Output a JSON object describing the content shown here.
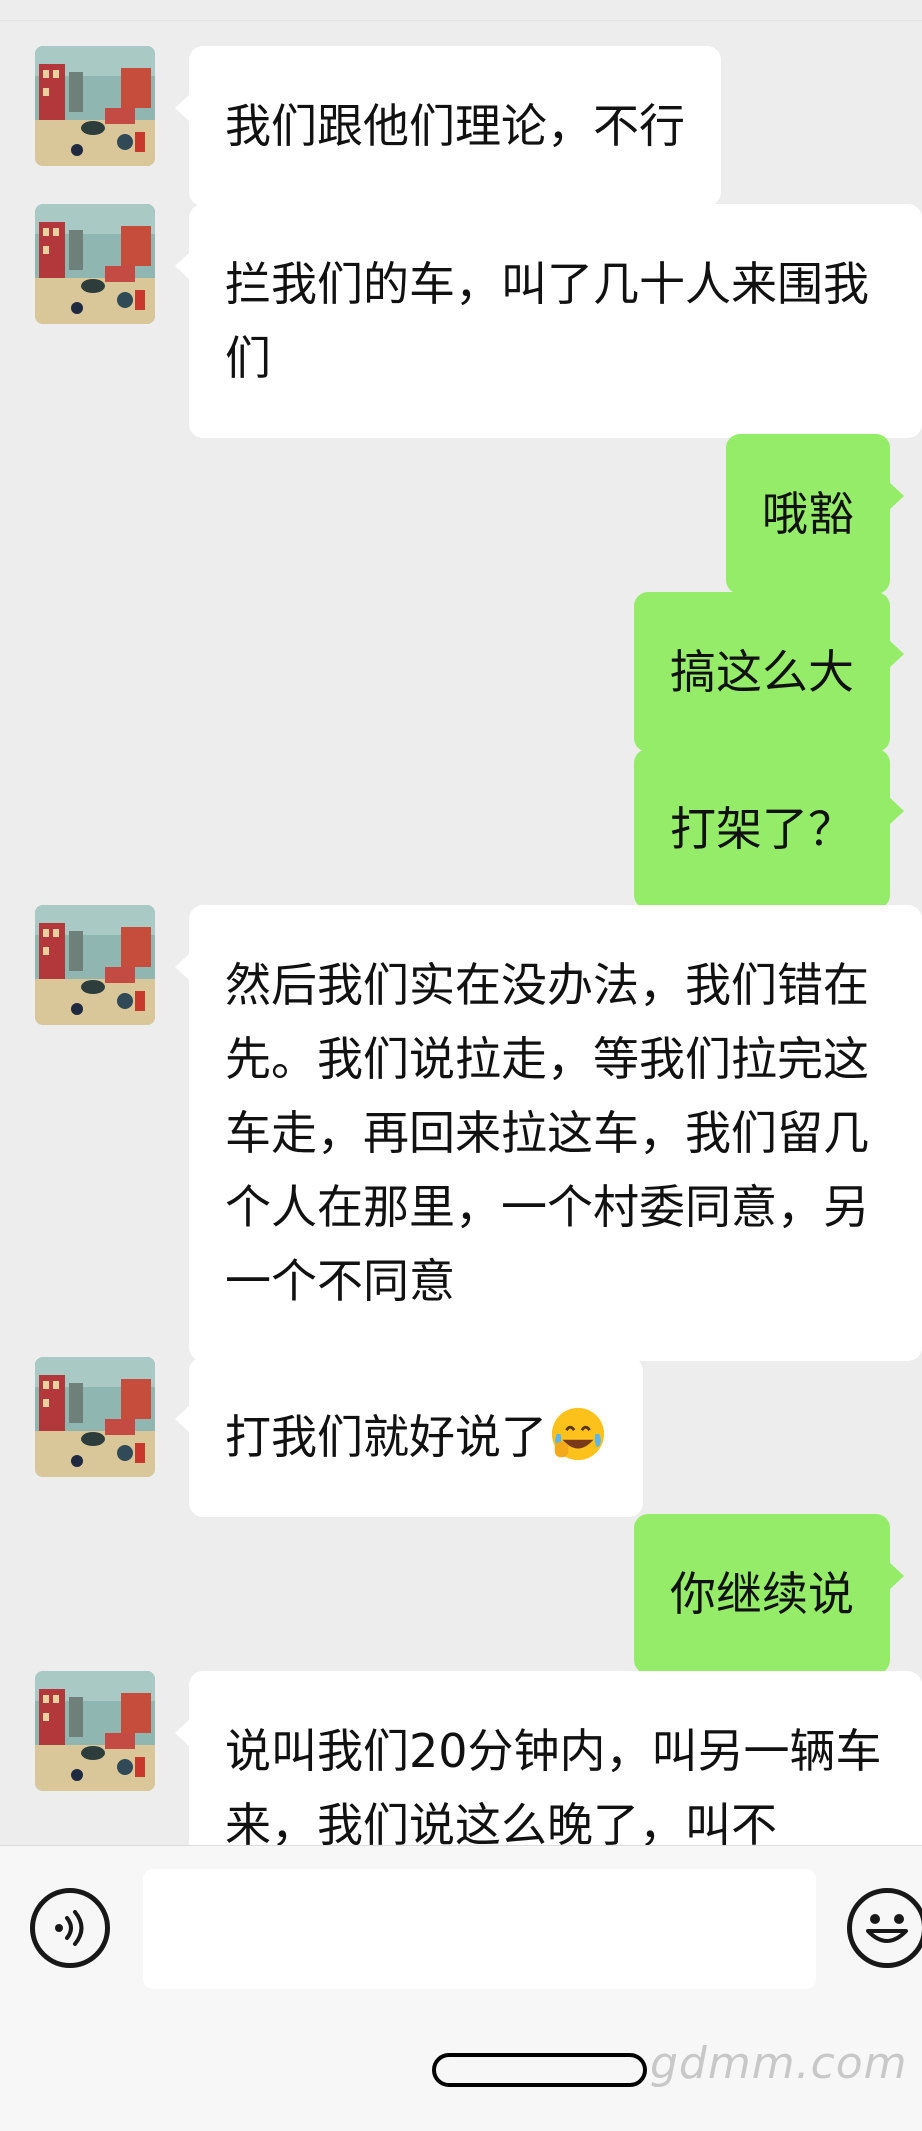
{
  "messages": [
    {
      "side": "left",
      "text": "我们跟他们理论，不行"
    },
    {
      "side": "left",
      "text": "拦我们的车，叫了几十人来围我们"
    },
    {
      "side": "right",
      "text": "哦豁"
    },
    {
      "side": "right",
      "text": "搞这么大"
    },
    {
      "side": "right",
      "text": "打架了？"
    },
    {
      "side": "left",
      "text": "然后我们实在没办法，我们错在先。我们说拉走，等我们拉完这车走，再回来拉这车，我们留几个人在那里，一个村委同意，另一个不同意"
    },
    {
      "side": "left",
      "text": "打我们就好说了",
      "emoji": "crying-laughing-emoji"
    },
    {
      "side": "right",
      "text": "你继续说"
    },
    {
      "side": "left",
      "text": "说叫我们20分钟内，叫另一辆车来，我们说这么晚了，叫不"
    }
  ],
  "input_bar": {
    "voice_icon": "voice-icon",
    "emoji_icon": "smiley-icon",
    "input_value": ""
  },
  "watermark": "gdmm.com",
  "colors": {
    "background": "#ededed",
    "incoming_bubble": "#ffffff",
    "outgoing_bubble": "#95ec69",
    "text": "#111111"
  }
}
